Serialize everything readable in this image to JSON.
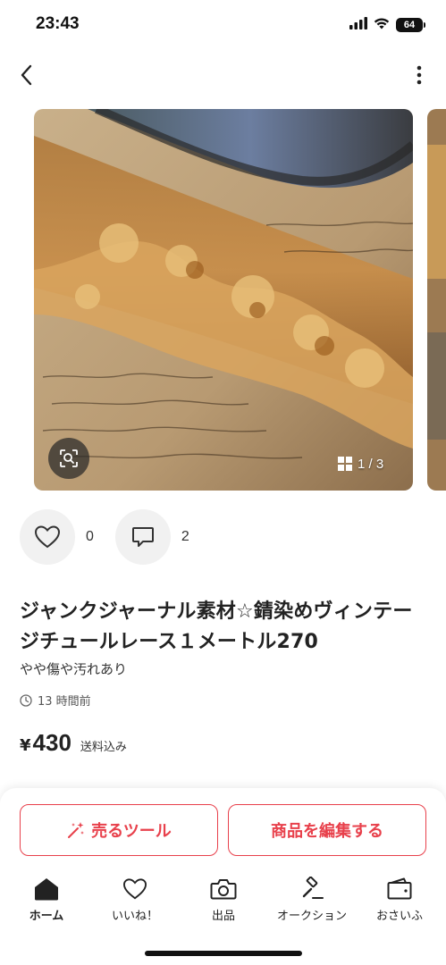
{
  "status_bar": {
    "time": "23:43",
    "battery": "64"
  },
  "nav": {
    "back_icon": "chevron-left-icon",
    "more_icon": "more-vertical-icon"
  },
  "gallery": {
    "page_indicator": "1 / 3",
    "lens_icon": "image-search-icon"
  },
  "engagement": {
    "likes": "0",
    "comments": "2"
  },
  "item": {
    "title": "ジャンクジャーナル素材☆錆染めヴィンテージチュールレース１メートル270",
    "condition": "やや傷や汚れあり",
    "time_ago": "13 時間前",
    "currency": "¥",
    "price": "430",
    "shipping": "送料込み"
  },
  "buttons": {
    "sell_tool": "売るツール",
    "edit_item": "商品を編集する"
  },
  "tabs": [
    {
      "label": "ホーム",
      "icon": "home-icon"
    },
    {
      "label": "いいね！",
      "icon": "heart-icon"
    },
    {
      "label": "出品",
      "icon": "camera-icon"
    },
    {
      "label": "オークション",
      "icon": "gavel-icon"
    },
    {
      "label": "おさいふ",
      "icon": "wallet-icon"
    }
  ],
  "colors": {
    "accent": "#e8404b",
    "text": "#222222",
    "button_bg": "#f1f1f1"
  }
}
